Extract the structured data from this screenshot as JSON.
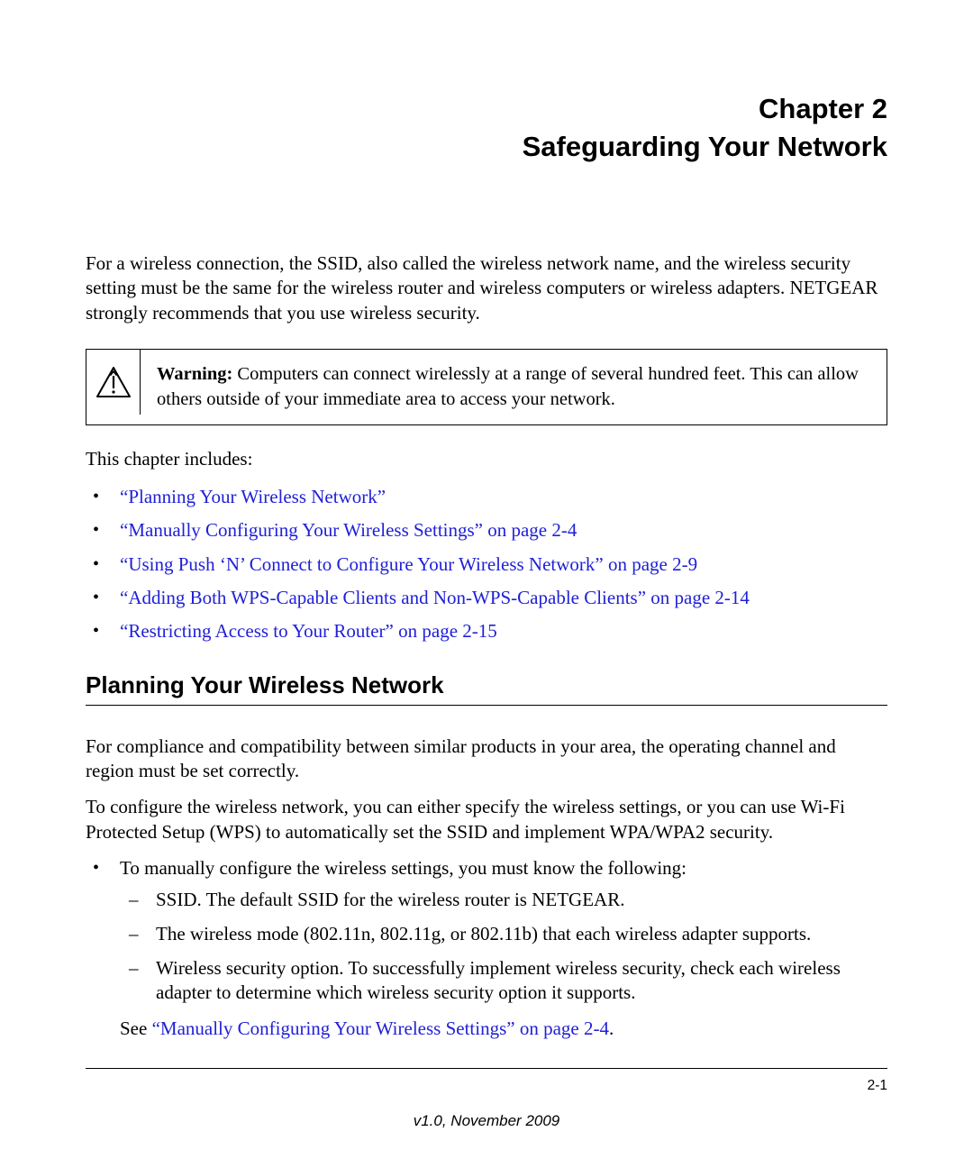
{
  "chapter": {
    "line1": "Chapter 2",
    "line2": "Safeguarding Your Network"
  },
  "intro": "For a wireless connection, the SSID, also called the wireless network name, and the wireless security setting must be the same for the wireless router and wireless computers or wireless adapters. NETGEAR strongly recommends that you use wireless security.",
  "warning": {
    "label": "Warning:",
    "text": " Computers can connect wirelessly at a range of several hundred feet. This can allow others outside of your immediate area to access your network."
  },
  "includes_line": "This chapter includes:",
  "toc": [
    "“Planning Your Wireless Network”",
    "“Manually Configuring Your Wireless Settings” on page 2-4",
    "“Using Push ‘N’ Connect to Configure Your Wireless Network” on page 2-9",
    "“Adding Both WPS-Capable Clients and Non-WPS-Capable Clients” on page 2-14",
    "“Restricting Access to Your Router” on page 2-15"
  ],
  "section": {
    "heading": "Planning Your Wireless Network",
    "para1": "For compliance and compatibility between similar products in your area, the operating channel and region must be set correctly.",
    "para2": "To configure the wireless network, you can either specify the wireless settings, or you can use Wi-Fi Protected Setup (WPS) to automatically set the SSID and implement WPA/WPA2 security.",
    "bullet1": "To manually configure the wireless settings, you must know the following:",
    "dash1": "SSID. The default SSID for the wireless router is NETGEAR.",
    "dash2": "The wireless mode (802.11n, 802.11g, or 802.11b) that each wireless adapter supports.",
    "dash3": "Wireless security option. To successfully implement wireless security, check each wireless adapter to determine which wireless security option it supports.",
    "see_prefix": "See ",
    "see_link": "“Manually Configuring Your Wireless Settings” on page 2-4",
    "see_suffix": "."
  },
  "footer": {
    "page": "2-1",
    "version": "v1.0, November 2009"
  }
}
